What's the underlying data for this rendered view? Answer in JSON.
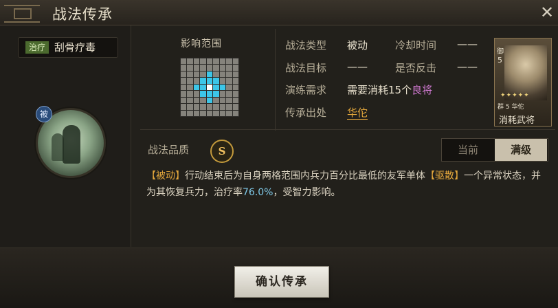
{
  "window": {
    "title": "战法传承"
  },
  "skill": {
    "category": "治疗",
    "name": "刮骨疗毒",
    "passive_badge": "被",
    "range_label": "影响范围"
  },
  "info": {
    "type_label": "战法类型",
    "type_value": "被动",
    "cooldown_label": "冷却时间",
    "cooldown_value": "——",
    "target_label": "战法目标",
    "target_value": "——",
    "counter_label": "是否反击",
    "counter_value": "——",
    "require_label": "演练需求",
    "require_prefix": "需要消耗",
    "require_count": "15个",
    "require_item": "良将",
    "source_label": "传承出处",
    "source_value": "华佗"
  },
  "hero_card": {
    "camp": "御",
    "cost": "5",
    "stars": "✦✦✦✦✦",
    "info": "群 5 华佗",
    "caption": "消耗武将"
  },
  "quality": {
    "label": "战法品质",
    "grade": "S"
  },
  "level_toggle": {
    "current": "当前",
    "max": "满级",
    "selected": "满级"
  },
  "description": {
    "tag_open": "【被动】",
    "text1": "行动结束后为自身两格范围内兵力百分比最低的友军单体",
    "tag_dispel": "【驱散】",
    "text2": "一个异常状态，并为其恢复兵力，治疗率",
    "rate": "76.0%",
    "text3": "，受智力影响。"
  },
  "actions": {
    "confirm": "确认传承"
  },
  "colors": {
    "hit": "#3cc6e8",
    "self": "#ffffff",
    "empty": "#85837c",
    "accent": "#e3a73c"
  },
  "icons": {
    "close": "close-icon",
    "skill": "skill-icon",
    "passive": "passive-badge-icon"
  },
  "range_grid": {
    "rows": 9,
    "cols": 9,
    "cells": [
      [
        0,
        0,
        0,
        0,
        0,
        0,
        0,
        0,
        0
      ],
      [
        0,
        0,
        0,
        0,
        0,
        0,
        0,
        0,
        0
      ],
      [
        0,
        0,
        0,
        0,
        1,
        0,
        0,
        0,
        0
      ],
      [
        0,
        0,
        0,
        1,
        1,
        1,
        0,
        0,
        0
      ],
      [
        0,
        0,
        1,
        1,
        2,
        1,
        1,
        0,
        0
      ],
      [
        0,
        0,
        0,
        1,
        1,
        1,
        0,
        0,
        0
      ],
      [
        0,
        0,
        0,
        0,
        1,
        0,
        0,
        0,
        0
      ],
      [
        0,
        0,
        0,
        0,
        0,
        0,
        0,
        0,
        0
      ],
      [
        0,
        0,
        0,
        0,
        0,
        0,
        0,
        0,
        0
      ]
    ]
  }
}
